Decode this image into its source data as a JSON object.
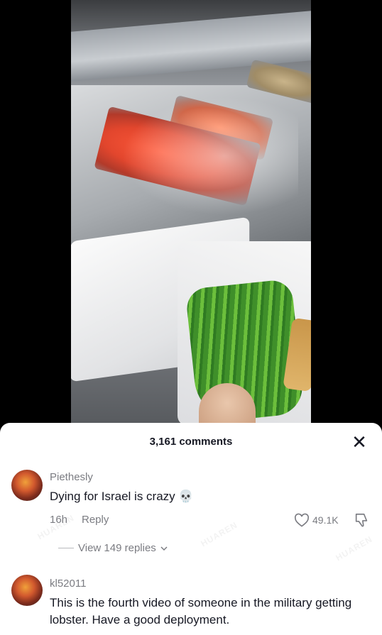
{
  "colors": {
    "sheet_bg": "#ffffff",
    "primary_text": "#161823",
    "secondary_text": "#7b7c82"
  },
  "sheet": {
    "comments_count": "3,161 comments",
    "close_label": "✕"
  },
  "comments": [
    {
      "username": "Piethesly",
      "text": "Dying for Israel is crazy 💀",
      "time": "16h",
      "reply_label": "Reply",
      "likes": "49.1K",
      "view_replies": "View 149 replies"
    },
    {
      "username": "kl52011",
      "text": "This is the fourth video of someone in the military getting lobster. Have a good deployment."
    }
  ],
  "icons": {
    "like": "heart-icon",
    "dislike": "thumbs-down-icon",
    "close": "close-icon",
    "chevron": "chevron-down-icon"
  }
}
